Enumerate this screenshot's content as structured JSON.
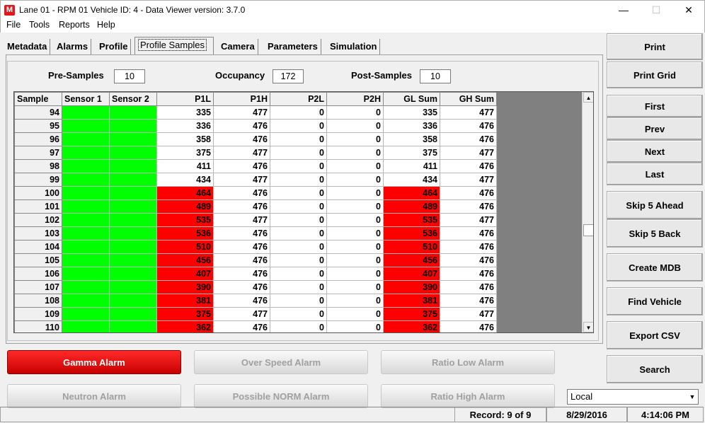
{
  "window": {
    "title": "Lane 01 - RPM 01  Vehicle ID: 4 - Data Viewer  version: 3.7.0",
    "minimize": "—",
    "maximize": "☐",
    "close": "✕",
    "app_icon": "M"
  },
  "menu": [
    "File",
    "Tools",
    "Reports",
    "Help"
  ],
  "tabs": [
    "Metadata",
    "Alarms",
    "Profile",
    "Profile Samples",
    "Camera",
    "Parameters",
    "Simulation"
  ],
  "active_tab": "Profile Samples",
  "header": {
    "pre_samples_label": "Pre-Samples",
    "pre_samples_value": "10",
    "occupancy_label": "Occupancy",
    "occupancy_value": "172",
    "post_samples_label": "Post-Samples",
    "post_samples_value": "10"
  },
  "grid": {
    "columns": [
      "Sample",
      "Sensor 1",
      "Sensor 2",
      "P1L",
      "P1H",
      "P2L",
      "P2H",
      "GL Sum",
      "GH Sum"
    ],
    "rows": [
      {
        "sample": "94",
        "s1": "green",
        "s2": "green",
        "p1l": "335",
        "p1h": "477",
        "p2l": "0",
        "p2h": "0",
        "gl": "335",
        "gh": "477",
        "alarm": false
      },
      {
        "sample": "95",
        "s1": "green",
        "s2": "green",
        "p1l": "336",
        "p1h": "476",
        "p2l": "0",
        "p2h": "0",
        "gl": "336",
        "gh": "476",
        "alarm": false
      },
      {
        "sample": "96",
        "s1": "green",
        "s2": "green",
        "p1l": "358",
        "p1h": "476",
        "p2l": "0",
        "p2h": "0",
        "gl": "358",
        "gh": "476",
        "alarm": false
      },
      {
        "sample": "97",
        "s1": "green",
        "s2": "green",
        "p1l": "375",
        "p1h": "477",
        "p2l": "0",
        "p2h": "0",
        "gl": "375",
        "gh": "477",
        "alarm": false
      },
      {
        "sample": "98",
        "s1": "green",
        "s2": "green",
        "p1l": "411",
        "p1h": "476",
        "p2l": "0",
        "p2h": "0",
        "gl": "411",
        "gh": "476",
        "alarm": false
      },
      {
        "sample": "99",
        "s1": "green",
        "s2": "green",
        "p1l": "434",
        "p1h": "477",
        "p2l": "0",
        "p2h": "0",
        "gl": "434",
        "gh": "477",
        "alarm": false
      },
      {
        "sample": "100",
        "s1": "green",
        "s2": "green",
        "p1l": "464",
        "p1h": "476",
        "p2l": "0",
        "p2h": "0",
        "gl": "464",
        "gh": "476",
        "alarm": true
      },
      {
        "sample": "101",
        "s1": "green",
        "s2": "green",
        "p1l": "489",
        "p1h": "476",
        "p2l": "0",
        "p2h": "0",
        "gl": "489",
        "gh": "476",
        "alarm": true
      },
      {
        "sample": "102",
        "s1": "green",
        "s2": "green",
        "p1l": "535",
        "p1h": "477",
        "p2l": "0",
        "p2h": "0",
        "gl": "535",
        "gh": "477",
        "alarm": true
      },
      {
        "sample": "103",
        "s1": "green",
        "s2": "green",
        "p1l": "536",
        "p1h": "476",
        "p2l": "0",
        "p2h": "0",
        "gl": "536",
        "gh": "476",
        "alarm": true
      },
      {
        "sample": "104",
        "s1": "green",
        "s2": "green",
        "p1l": "510",
        "p1h": "476",
        "p2l": "0",
        "p2h": "0",
        "gl": "510",
        "gh": "476",
        "alarm": true
      },
      {
        "sample": "105",
        "s1": "green",
        "s2": "green",
        "p1l": "456",
        "p1h": "476",
        "p2l": "0",
        "p2h": "0",
        "gl": "456",
        "gh": "476",
        "alarm": true
      },
      {
        "sample": "106",
        "s1": "green",
        "s2": "green",
        "p1l": "407",
        "p1h": "476",
        "p2l": "0",
        "p2h": "0",
        "gl": "407",
        "gh": "476",
        "alarm": true
      },
      {
        "sample": "107",
        "s1": "green",
        "s2": "green",
        "p1l": "390",
        "p1h": "476",
        "p2l": "0",
        "p2h": "0",
        "gl": "390",
        "gh": "476",
        "alarm": true
      },
      {
        "sample": "108",
        "s1": "green",
        "s2": "green",
        "p1l": "381",
        "p1h": "476",
        "p2l": "0",
        "p2h": "0",
        "gl": "381",
        "gh": "476",
        "alarm": true
      },
      {
        "sample": "109",
        "s1": "green",
        "s2": "green",
        "p1l": "375",
        "p1h": "477",
        "p2l": "0",
        "p2h": "0",
        "gl": "375",
        "gh": "477",
        "alarm": true
      },
      {
        "sample": "110",
        "s1": "green",
        "s2": "green",
        "p1l": "362",
        "p1h": "476",
        "p2l": "0",
        "p2h": "0",
        "gl": "362",
        "gh": "476",
        "alarm": true
      }
    ]
  },
  "colors": {
    "sensor_on": "#00ff00",
    "alarm": "#ff0000",
    "grid_empty": "#808080"
  },
  "right_buttons": [
    "Print",
    "Print Grid",
    "First",
    "Prev",
    "Next",
    "Last",
    "Skip 5 Ahead",
    "Skip 5 Back",
    "Create MDB",
    "Find Vehicle",
    "Export CSV",
    "Search"
  ],
  "alarms": [
    {
      "label": "Gamma Alarm",
      "active": true
    },
    {
      "label": "Over Speed Alarm",
      "active": false
    },
    {
      "label": "Ratio Low Alarm",
      "active": false
    },
    {
      "label": "Neutron Alarm",
      "active": false
    },
    {
      "label": "Possible NORM Alarm",
      "active": false
    },
    {
      "label": "Ratio High Alarm",
      "active": false
    }
  ],
  "location_select": {
    "value": "Local"
  },
  "status": {
    "record": "Record: 9 of 9",
    "date": "8/29/2016",
    "time": "4:14:06 PM"
  }
}
